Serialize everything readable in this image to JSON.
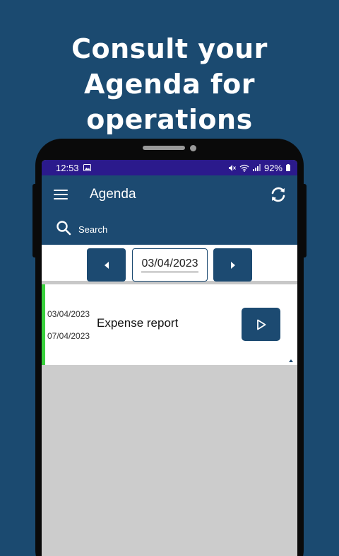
{
  "promo": {
    "line1": "Consult your",
    "line2": "Agenda for",
    "line3": "operations"
  },
  "statusbar": {
    "time": "12:53",
    "battery": "92%"
  },
  "appbar": {
    "title": "Agenda",
    "search_label": "Search"
  },
  "datebar": {
    "current_date": "03/04/2023"
  },
  "events": [
    {
      "start_date": "03/04/2023",
      "end_date": "07/04/2023",
      "title": "Expense report",
      "status_color": "#39d13c"
    }
  ],
  "colors": {
    "background": "#1b4a70",
    "primary": "#1c4a71",
    "statusbar": "#2b1a8c",
    "accent": "#39d13c"
  },
  "icons": {
    "menu": "menu-icon",
    "sync": "sync-icon",
    "search": "search-icon",
    "prev": "chevron-left-icon",
    "next": "chevron-right-icon",
    "play": "play-icon"
  }
}
